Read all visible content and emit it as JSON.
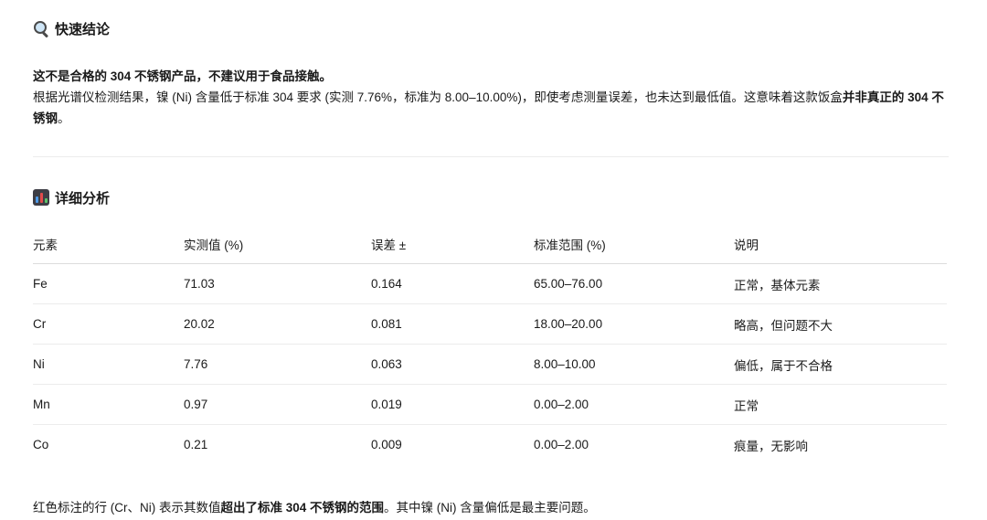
{
  "quick_conclusion": {
    "heading": "快速结论",
    "headline": "这不是合格的 304 不锈钢产品，不建议用于食品接触。",
    "body_part1": "根据光谱仪检测结果，镍 (Ni) 含量低于标准 304 要求 (实测 7.76%，标准为 8.00–10.00%)，即使考虑测量误差，也未达到最低值。这意味着这款饭盒",
    "body_bold": "并非真正的 304 不锈钢",
    "body_part2": "。"
  },
  "detailed_analysis": {
    "heading": "详细分析",
    "columns": [
      "元素",
      "实测值 (%)",
      "误差 ±",
      "标准范围 (%)",
      "说明"
    ],
    "rows": [
      {
        "element": "Fe",
        "measured": "71.03",
        "error": "0.164",
        "range": "65.00–76.00",
        "note": "正常，基体元素"
      },
      {
        "element": "Cr",
        "measured": "20.02",
        "error": "0.081",
        "range": "18.00–20.00",
        "note": "略高，但问题不大"
      },
      {
        "element": "Ni",
        "measured": "7.76",
        "error": "0.063",
        "range": "8.00–10.00",
        "note": "偏低，属于不合格"
      },
      {
        "element": "Mn",
        "measured": "0.97",
        "error": "0.019",
        "range": "0.00–2.00",
        "note": "正常"
      },
      {
        "element": "Co",
        "measured": "0.21",
        "error": "0.009",
        "range": "0.00–2.00",
        "note": "痕量，无影响"
      }
    ]
  },
  "footnote": {
    "part1": "红色标注的行 (Cr、Ni) 表示其数值",
    "bold": "超出了标准 304 不锈钢的范围",
    "part2": "。其中镍 (Ni) 含量偏低是最主要问题。"
  },
  "icons": {
    "quick_conclusion_icon": "magnifier-icon",
    "detailed_analysis_icon": "bar-chart-icon"
  }
}
